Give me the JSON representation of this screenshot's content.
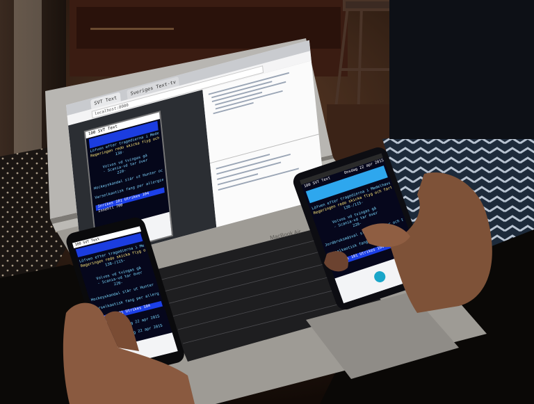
{
  "scene": {
    "description_label": "",
    "laptop_brand": "MacBook Air"
  },
  "laptop": {
    "browser": {
      "tabs": [
        "SVT Text",
        "Sveriges Text-tv"
      ],
      "url": "localhost:8080"
    },
    "emulator": {
      "page_num": "100",
      "page_title": "SVT Text",
      "date": "Onsdag 22 apr 2015",
      "lines": [
        "Löfven efter tragedierna i Medelhavet:",
        "Regeringen redo skicka flyg och fartyg",
        "138-",
        "Volvos vd tvingas gå",
        "- Scania-vd tar över",
        "220-",
        "Hockeyskandal slår ut Hunter och bin",
        "Varselkaotisk fang per allergier - 128",
        "Inrikes 101 Utrikes 104 Innehll 700"
      ]
    }
  },
  "phone_left": {
    "title": "100 SVT Text",
    "lines": [
      "Löfven efter tragedierna i Medelhavet:",
      "Regeringen redo skicka flyg och fartyg",
      "138-/115-",
      "Volvos vd tvingas gå",
      "- Scania-vd tar över",
      "220-",
      "Hockeyskandal slår ut Hunter och bin",
      "Varselkaotisk fang per allergier - 128",
      "Inrikes 101 Utrikes 104 Innehll 700",
      "Onsdag 22 apr 2015",
      "Onsdag 22 apr 2015"
    ]
  },
  "phone_right": {
    "title": "100 SVT Text",
    "date": "Onsdag 22 apr 2015",
    "lines": [
      "Löfven efter tragedierna i Medelhavet:",
      "Regeringen redo skicka flyg och fartyg",
      "138-/115-",
      "Volvos vd tvingas gå",
      "- Scania-vd tar över",
      "220-",
      "Jordbruksmäsval slår ut Hunter och bin",
      "Varselkaotisk fang per allergier",
      "Inrikes 101 Utrikes 104 Innehll 700"
    ]
  }
}
